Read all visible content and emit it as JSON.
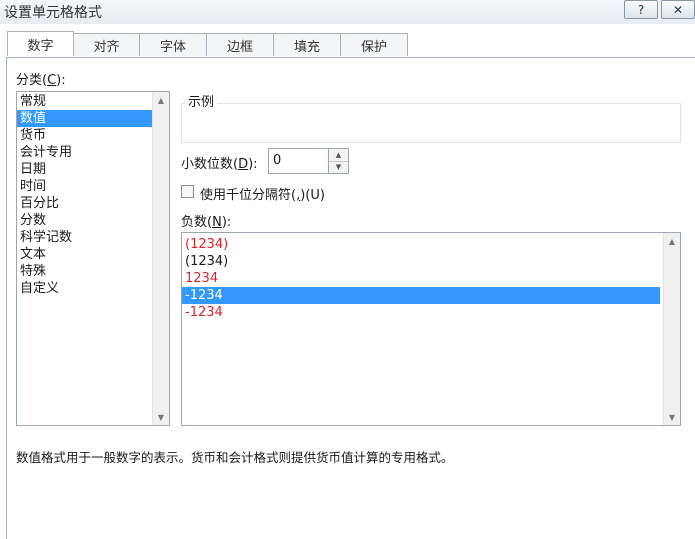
{
  "window": {
    "title": "设置单元格格式",
    "help_label": "?",
    "close_label": "✕"
  },
  "tabs": [
    {
      "label": "数字",
      "active": true
    },
    {
      "label": "对齐",
      "active": false
    },
    {
      "label": "字体",
      "active": false
    },
    {
      "label": "边框",
      "active": false
    },
    {
      "label": "填充",
      "active": false
    },
    {
      "label": "保护",
      "active": false
    }
  ],
  "category": {
    "label": "分类(",
    "accel": "C",
    "label_end": "):",
    "items": [
      "常规",
      "数值",
      "货币",
      "会计专用",
      "日期",
      "时间",
      "百分比",
      "分数",
      "科学记数",
      "文本",
      "特殊",
      "自定义"
    ],
    "selected": "数值"
  },
  "sample": {
    "legend": "示例",
    "value": ""
  },
  "decimal_places": {
    "label": "小数位数(",
    "accel": "D",
    "label_end": "):",
    "value": "0"
  },
  "thousands_separator": {
    "label": "使用千位分隔符(",
    "accel": ",",
    "label_end": ")(U)",
    "checked": false
  },
  "negative_numbers": {
    "label": "负数(",
    "accel": "N",
    "label_end": "):",
    "items": [
      {
        "text": "(1234)",
        "color": "#d9262c"
      },
      {
        "text": "(1234)",
        "color": "#1a1a1a"
      },
      {
        "text": "1234",
        "color": "#d9262c"
      },
      {
        "text": "-1234",
        "color": "#1a1a1a"
      },
      {
        "text": "-1234",
        "color": "#d9262c"
      }
    ],
    "selected_index": 3
  },
  "description": "数值格式用于一般数字的表示。货币和会计格式则提供货币值计算的专用格式。",
  "colors": {
    "selection": "#3399ff",
    "negative_red": "#d9262c"
  }
}
